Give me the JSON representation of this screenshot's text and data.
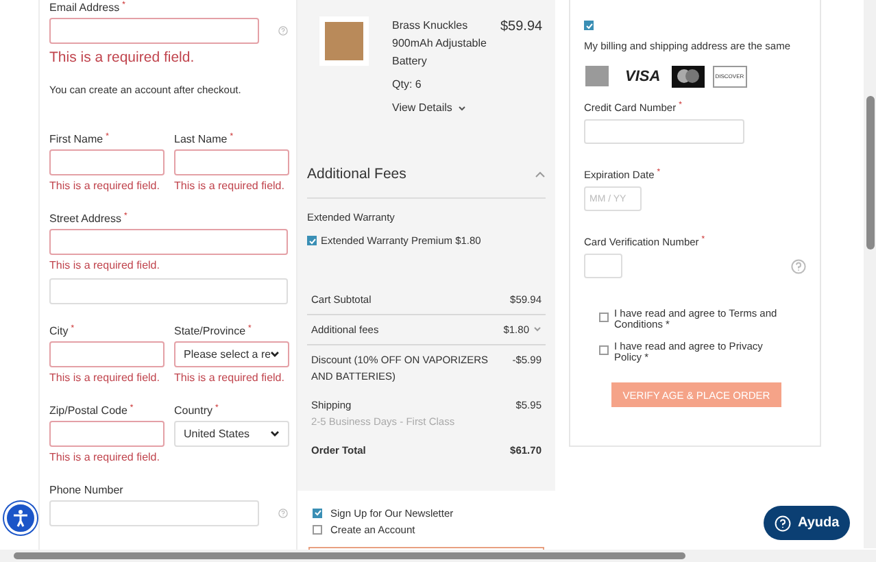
{
  "shipping_form": {
    "rows": [
      {
        "fields": [
          {
            "label": "Email Address",
            "asterisk": "*",
            "kind": "input",
            "help": true,
            "error": "This is a required field."
          }
        ],
        "note": "You can create an account after checkout."
      },
      {
        "fields": [
          {
            "label": "First Name",
            "asterisk": "*",
            "kind": "input",
            "error": "This is a required field."
          },
          {
            "label": "Last Name",
            "asterisk": "*",
            "kind": "input",
            "error": "This is a required field."
          }
        ]
      },
      {
        "fields": [
          {
            "label": "Street Address",
            "asterisk": "*",
            "kind": "input",
            "error": "This is a required field."
          }
        ]
      },
      {
        "fields": [
          {
            "kind": "input"
          }
        ]
      },
      {
        "fields": [
          {
            "label": "City",
            "asterisk": "*",
            "kind": "input",
            "error": "This is a required field."
          },
          {
            "label": "State/Province",
            "asterisk": "*",
            "kind": "select",
            "value": "Please select a re",
            "error": "This is a required field."
          }
        ]
      },
      {
        "fields": [
          {
            "label": "Zip/Postal Code",
            "asterisk": "*",
            "kind": "input",
            "error": "This is a required field."
          },
          {
            "label": "Country",
            "asterisk": "*",
            "kind": "select",
            "value": "United States"
          }
        ]
      },
      {
        "fields": [
          {
            "label": "Phone Number",
            "kind": "input",
            "help": true
          }
        ]
      }
    ]
  },
  "order_summary": {
    "item": {
      "name": "Brass Knuckles 900mAh Adjustable Battery",
      "price": "$59.94",
      "qty": "Qty: 6",
      "details": "View Details"
    },
    "fees": {
      "title": "Additional Fees",
      "expanded": true,
      "group": "Extended Warranty",
      "option": {
        "label": "Extended Warranty Premium $1.80",
        "checked": true
      }
    },
    "totals": [
      {
        "label": "Cart Subtotal",
        "value": "$59.94",
        "divider": true
      },
      {
        "label": "Additional fees",
        "value": "$1.80",
        "caret": true,
        "divider": true
      },
      {
        "label": "Discount (10% OFF ON VAPORIZERS AND BATTERIES)",
        "value": "-$5.99"
      },
      {
        "label": "Shipping",
        "value": "$5.95",
        "sub": "2-5 Business Days - First Class"
      },
      {
        "label": "Order Total",
        "value": "$61.70",
        "bold": true
      }
    ],
    "options": [
      {
        "label": "Sign Up for Our Newsletter",
        "checked": true
      },
      {
        "label": "Create an Account",
        "checked": false
      }
    ]
  },
  "payment": {
    "same_address": {
      "label": "My billing and shipping address are the same",
      "checked": true
    },
    "cards": [
      {
        "kind": "amex"
      },
      {
        "kind": "visa",
        "text": "VISA"
      },
      {
        "kind": "mastercard"
      },
      {
        "kind": "discover",
        "text": "DISCOVER"
      }
    ],
    "fields": [
      {
        "label": "Credit Card Number",
        "asterisk": "*"
      },
      {
        "label": "Expiration Date",
        "asterisk": "*",
        "placeholder": "MM / YY"
      },
      {
        "label": "Card Verification Number",
        "asterisk": "*",
        "help": true
      }
    ],
    "agreements": [
      {
        "label": "I have read and agree to Terms and Conditions *",
        "checked": false
      },
      {
        "label": "I have read and agree to Privacy Policy *",
        "checked": false
      }
    ],
    "submit": "VERIFY AGE & PLACE ORDER"
  },
  "help_button": "Ayuda"
}
